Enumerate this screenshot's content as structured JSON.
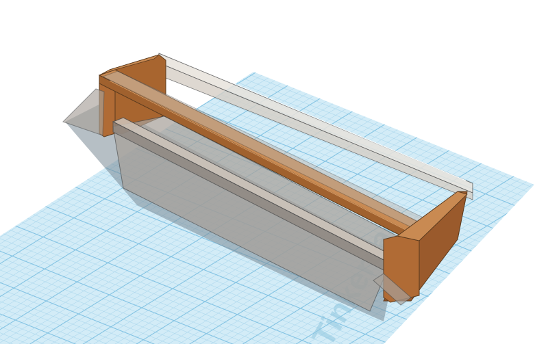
{
  "scene": {
    "workplane_watermark": "Tinkercad",
    "colors": {
      "background": "#ffffff",
      "grid_fill": "#d3ecf7",
      "grid_minor": "#a9d6ec",
      "grid_major": "#7fc1e2",
      "wood_front": "#b06b35",
      "wood_side": "#9a5a2c",
      "wood_top": "#c98a52",
      "ghost_fill": "#a8a19a",
      "ghost_edge": "#5a5a5a",
      "shadow": "#7a8a96"
    }
  }
}
